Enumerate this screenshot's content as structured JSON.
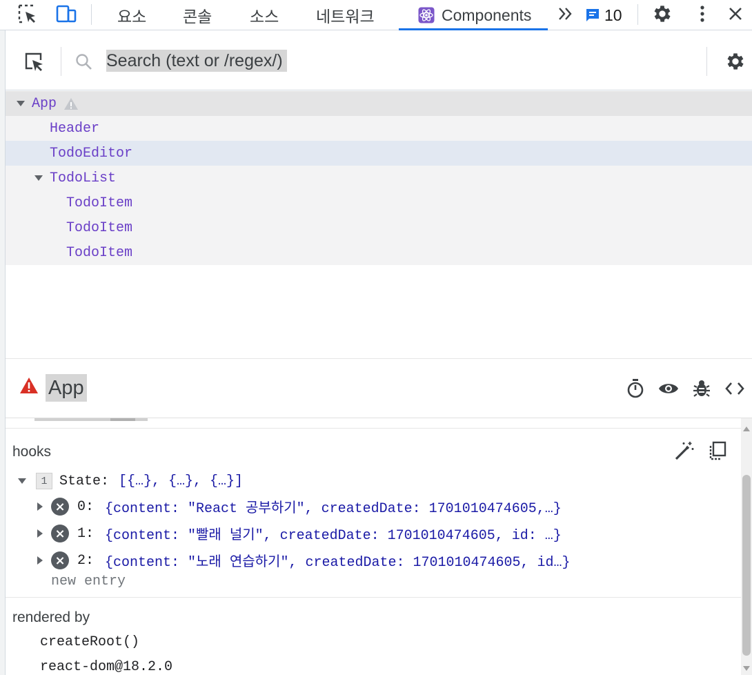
{
  "tabs": {
    "elements": "요소",
    "console": "콘솔",
    "sources": "소스",
    "network": "네트워크",
    "components": "Components",
    "issues_count": "10"
  },
  "search": {
    "placeholder": "Search (text or /regex/)"
  },
  "tree": {
    "items": [
      {
        "label": "App",
        "depth": 0,
        "expanded": true,
        "warning": true
      },
      {
        "label": "Header",
        "depth": 1
      },
      {
        "label": "TodoEditor",
        "depth": 1,
        "selected": true
      },
      {
        "label": "TodoList",
        "depth": 1,
        "expanded": true
      },
      {
        "label": "TodoItem",
        "depth": 2
      },
      {
        "label": "TodoItem",
        "depth": 2
      },
      {
        "label": "TodoItem",
        "depth": 2
      }
    ]
  },
  "selected_component": {
    "name": "App"
  },
  "hooks": {
    "title": "hooks",
    "state": {
      "index": "1",
      "key": "State:",
      "summary": "[{…}, {…}, {…}]",
      "entries": [
        {
          "key": "0:",
          "value": "{content: \"React 공부하기\", createdDate: 1701010474605,…}"
        },
        {
          "key": "1:",
          "value": "{content: \"빨래 널기\", createdDate: 1701010474605, id: …}"
        },
        {
          "key": "2:",
          "value": "{content: \"노래 연습하기\", createdDate: 1701010474605, id…}"
        }
      ],
      "new_entry": "new entry"
    }
  },
  "rendered_by": {
    "title": "rendered by",
    "items": [
      "createRoot()",
      "react-dom@18.2.0"
    ]
  },
  "colors": {
    "accent": "#1a73e8",
    "component_purple": "#6a3fc7",
    "warning_red": "#d93025"
  }
}
